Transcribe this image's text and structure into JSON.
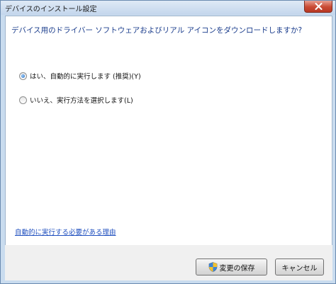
{
  "window": {
    "title": "デバイスのインストール設定"
  },
  "content": {
    "question": "デバイス用のドライバー ソフトウェアおよびリアル アイコンをダウンロードしますか?",
    "options": [
      {
        "label": "はい、自動的に実行します (推奨)(Y)",
        "selected": true
      },
      {
        "label": "いいえ、実行方法を選択します(L)",
        "selected": false
      }
    ],
    "help_link": "自動的に実行する必要がある理由"
  },
  "footer": {
    "save_label": "変更の保存",
    "cancel_label": "キャンセル",
    "save_icon": "uac-shield-icon"
  },
  "colors": {
    "question_text": "#1a3c8c",
    "link": "#1f4fbf",
    "close_button": "#c94a33",
    "footer_bg": "#f0f0f0"
  }
}
